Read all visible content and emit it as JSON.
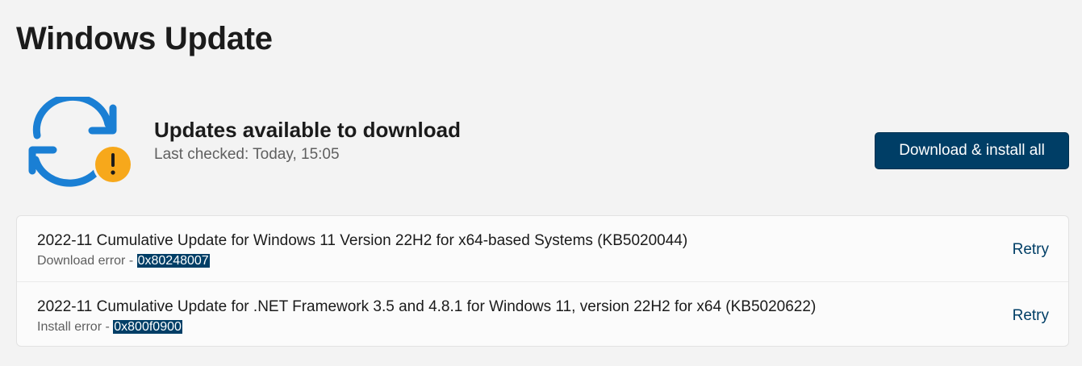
{
  "page": {
    "title": "Windows Update"
  },
  "status": {
    "icon": "sync-warning-icon",
    "title": "Updates available to download",
    "last_checked": "Last checked: Today, 15:05"
  },
  "actions": {
    "download_install_all": "Download & install all"
  },
  "updates": [
    {
      "name": "2022-11 Cumulative Update for Windows 11 Version 22H2 for x64-based Systems (KB5020044)",
      "error_label": "Download error - ",
      "error_code": "0x80248007",
      "action": "Retry"
    },
    {
      "name": "2022-11 Cumulative Update for .NET Framework 3.5 and 4.8.1 for Windows 11, version 22H2 for x64 (KB5020622)",
      "error_label": "Install error - ",
      "error_code": "0x800f0900",
      "action": "Retry"
    }
  ],
  "colors": {
    "background": "#f3f3f3",
    "accent": "#003e66",
    "sync_blue": "#1a7fd4",
    "warning": "#f7a81b"
  }
}
